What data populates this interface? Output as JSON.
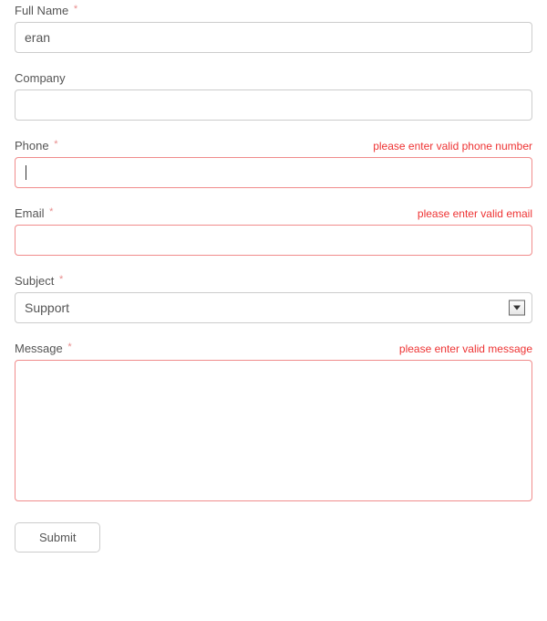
{
  "form": {
    "fullName": {
      "label": "Full Name",
      "required": true,
      "value": "eran",
      "error": ""
    },
    "company": {
      "label": "Company",
      "required": false,
      "value": "",
      "error": ""
    },
    "phone": {
      "label": "Phone",
      "required": true,
      "value": "",
      "error": "please enter valid phone number"
    },
    "email": {
      "label": "Email",
      "required": true,
      "value": "",
      "error": "please enter valid email"
    },
    "subject": {
      "label": "Subject",
      "required": true,
      "value": "Support",
      "error": ""
    },
    "message": {
      "label": "Message",
      "required": true,
      "value": "",
      "error": "please enter valid message"
    },
    "submit": {
      "label": "Submit"
    },
    "asterisk": "*"
  }
}
